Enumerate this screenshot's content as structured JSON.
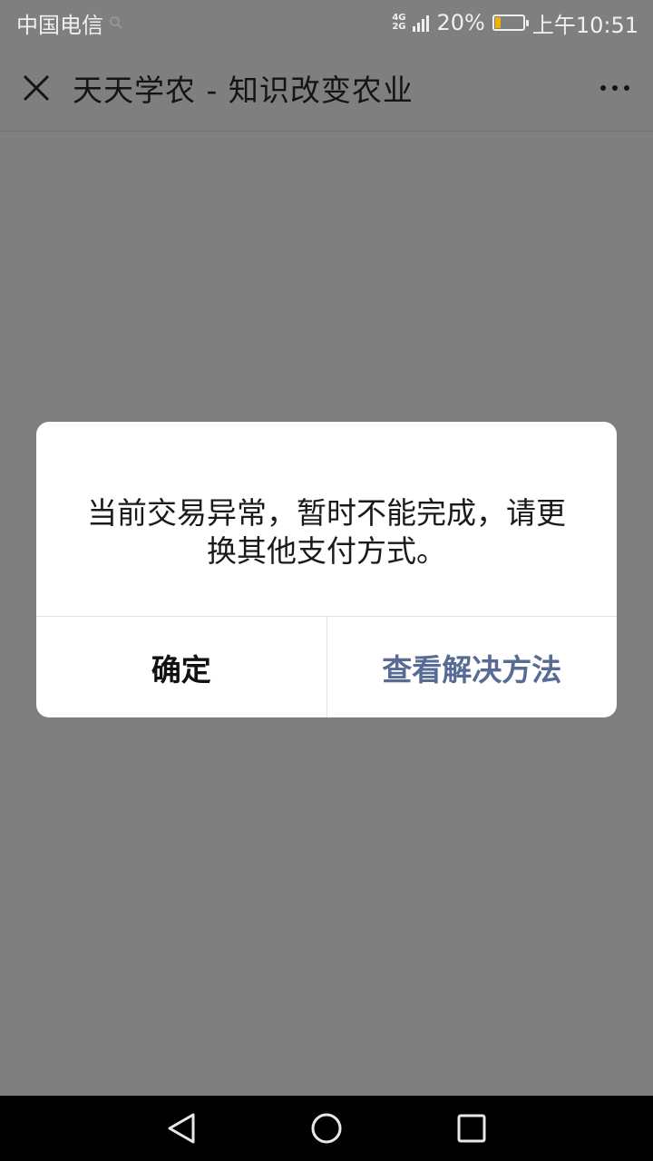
{
  "status_bar": {
    "carrier": "中国电信",
    "network_top": "4G",
    "network_bottom": "2G",
    "battery_percent": "20%",
    "battery_level": 0.2,
    "time": "上午10:51"
  },
  "title_bar": {
    "title": "天天学农 - 知识改变农业",
    "close_icon": "close-icon",
    "more_icon": "more-icon"
  },
  "dialog": {
    "message": "当前交易异常，暂时不能完成，请更换其他支付方式。",
    "confirm_label": "确定",
    "solution_label": "查看解决方法"
  },
  "nav_bar": {
    "icons": [
      "back-icon",
      "home-icon",
      "recents-icon"
    ]
  },
  "colors": {
    "overlay_background": "#7f7f7f",
    "link_blue": "#576b95",
    "battery_low": "#f0b000"
  }
}
